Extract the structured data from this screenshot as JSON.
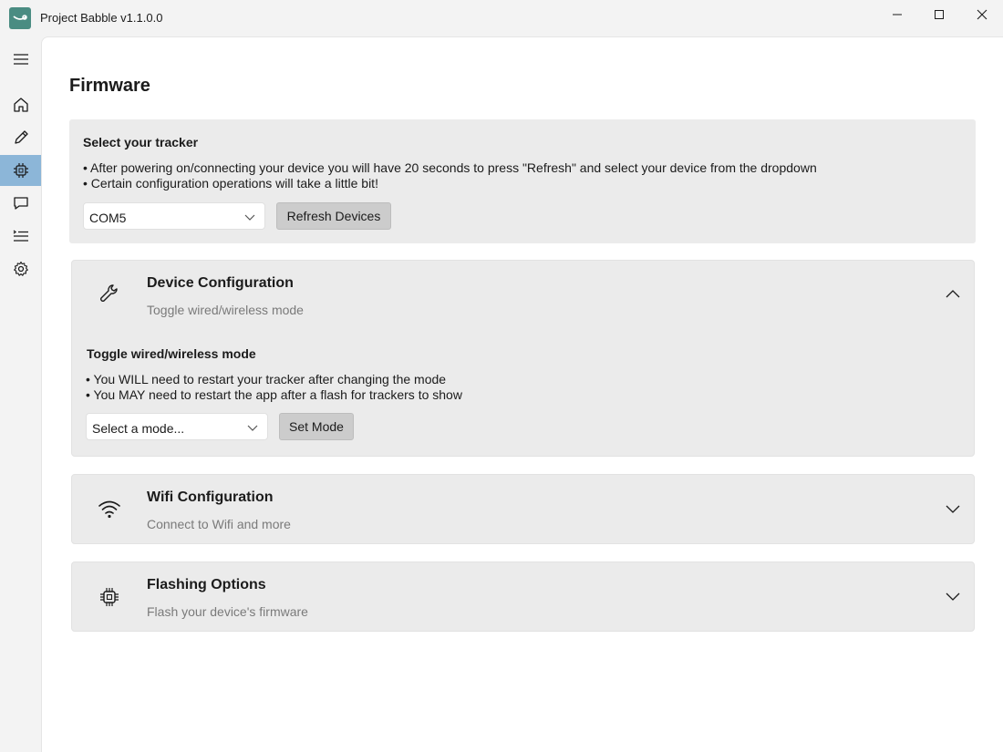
{
  "window": {
    "title": "Project Babble v1.1.0.0"
  },
  "icons": {
    "app": "project-babble-logo",
    "minimize": "minimize-icon",
    "maximize": "maximize-icon",
    "close": "close-icon"
  },
  "sidebar": {
    "items": [
      {
        "name": "menu",
        "icon": "hamburger-menu-icon"
      },
      {
        "name": "home",
        "icon": "home-icon"
      },
      {
        "name": "calibration",
        "icon": "pencil-icon"
      },
      {
        "name": "firmware",
        "icon": "chip-icon",
        "active": true
      },
      {
        "name": "feedback",
        "icon": "chat-icon"
      },
      {
        "name": "logs",
        "icon": "list-icon"
      },
      {
        "name": "settings",
        "icon": "gear-icon"
      }
    ],
    "active_color": "#8cb6d8"
  },
  "page": {
    "title": "Firmware"
  },
  "tracker": {
    "heading": "Select your tracker",
    "bullets": [
      "• After powering on/connecting your device you will have 20 seconds to press \"Refresh\" and select your device from the dropdown",
      "• Certain configuration operations will take a little bit!"
    ],
    "port_value": "COM5",
    "refresh_label": "Refresh Devices"
  },
  "device_config": {
    "title": "Device Configuration",
    "subtitle": "Toggle wired/wireless mode",
    "expanded": true,
    "heading": "Toggle wired/wireless mode",
    "bullets": [
      "• You WILL need to restart your tracker after changing the mode",
      "• You MAY need to restart the app after a flash for trackers to show"
    ],
    "mode_placeholder": "Select a mode...",
    "set_mode_label": "Set Mode"
  },
  "wifi_config": {
    "title": "Wifi Configuration",
    "subtitle": "Connect to Wifi and more",
    "expanded": false
  },
  "flashing": {
    "title": "Flashing Options",
    "subtitle": "Flash your device's firmware",
    "expanded": false
  }
}
